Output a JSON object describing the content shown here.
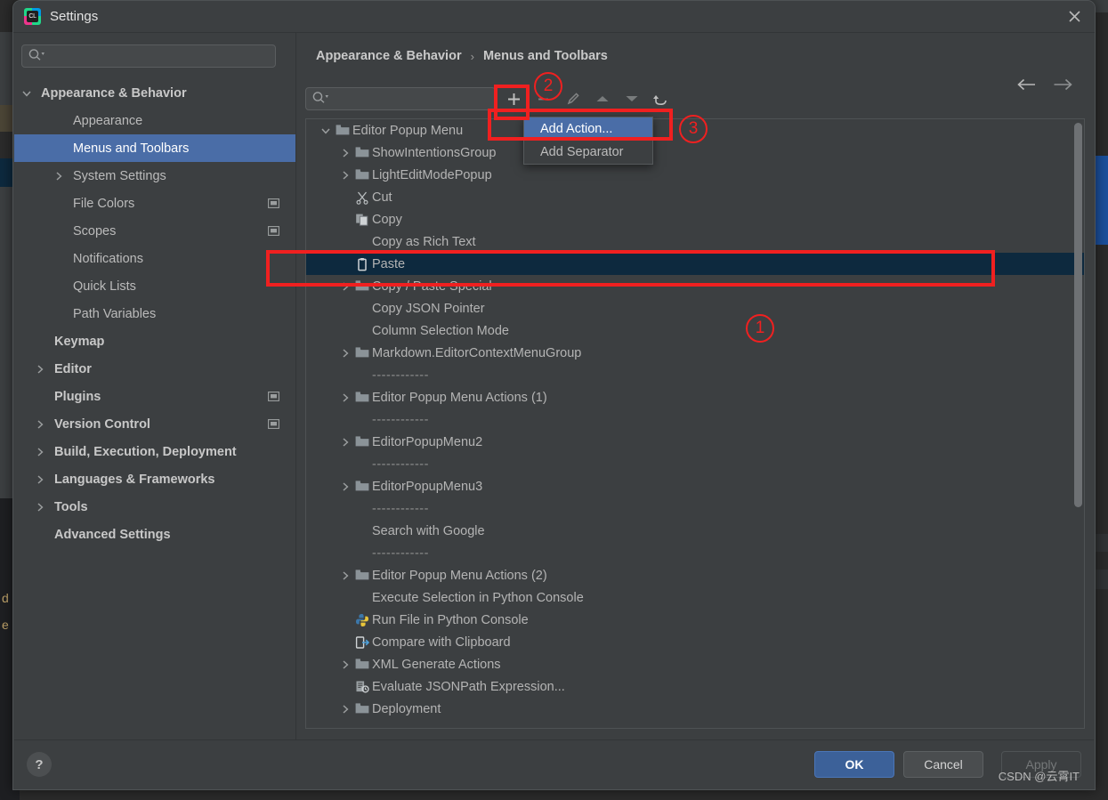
{
  "window": {
    "title": "Settings",
    "app_icon": "pycharm-logo-icon",
    "close_icon": "close-icon"
  },
  "nav_search": {
    "placeholder": "",
    "value": "",
    "icon": "search-dropdown-icon"
  },
  "sidebar": {
    "items": [
      {
        "label": "Appearance & Behavior",
        "indent": 30,
        "arrow": "chevron-down",
        "bold": true,
        "selected": false,
        "badge": false
      },
      {
        "label": "Appearance",
        "indent": 66,
        "arrow": "",
        "bold": false,
        "selected": false,
        "badge": false
      },
      {
        "label": "Menus and Toolbars",
        "indent": 66,
        "arrow": "",
        "bold": false,
        "selected": true,
        "badge": false
      },
      {
        "label": "System Settings",
        "indent": 66,
        "arrow": "chevron-right",
        "bold": false,
        "selected": false,
        "badge": false
      },
      {
        "label": "File Colors",
        "indent": 66,
        "arrow": "",
        "bold": false,
        "selected": false,
        "badge": true
      },
      {
        "label": "Scopes",
        "indent": 66,
        "arrow": "",
        "bold": false,
        "selected": false,
        "badge": true
      },
      {
        "label": "Notifications",
        "indent": 66,
        "arrow": "",
        "bold": false,
        "selected": false,
        "badge": false
      },
      {
        "label": "Quick Lists",
        "indent": 66,
        "arrow": "",
        "bold": false,
        "selected": false,
        "badge": false
      },
      {
        "label": "Path Variables",
        "indent": 66,
        "arrow": "",
        "bold": false,
        "selected": false,
        "badge": false
      },
      {
        "label": "Keymap",
        "indent": 45,
        "arrow": "",
        "bold": true,
        "selected": false,
        "badge": false
      },
      {
        "label": "Editor",
        "indent": 45,
        "arrow": "chevron-right",
        "bold": true,
        "selected": false,
        "badge": false
      },
      {
        "label": "Plugins",
        "indent": 45,
        "arrow": "",
        "bold": true,
        "selected": false,
        "badge": true
      },
      {
        "label": "Version Control",
        "indent": 45,
        "arrow": "chevron-right",
        "bold": true,
        "selected": false,
        "badge": true
      },
      {
        "label": "Build, Execution, Deployment",
        "indent": 45,
        "arrow": "chevron-right",
        "bold": true,
        "selected": false,
        "badge": false
      },
      {
        "label": "Languages & Frameworks",
        "indent": 45,
        "arrow": "chevron-right",
        "bold": true,
        "selected": false,
        "badge": false
      },
      {
        "label": "Tools",
        "indent": 45,
        "arrow": "chevron-right",
        "bold": true,
        "selected": false,
        "badge": false
      },
      {
        "label": "Advanced Settings",
        "indent": 45,
        "arrow": "",
        "bold": true,
        "selected": false,
        "badge": false
      }
    ]
  },
  "breadcrumb": {
    "root": "Appearance & Behavior",
    "separator": "›",
    "leaf": "Menus and Toolbars"
  },
  "pane_nav": {
    "back_icon": "arrow-left-icon",
    "forward_icon": "arrow-right-icon"
  },
  "tree_search": {
    "placeholder": "",
    "value": "",
    "icon": "search-dropdown-icon"
  },
  "toolbar": {
    "buttons": [
      {
        "name": "add-button",
        "label": "+",
        "icon": "plus-icon",
        "enabled": true
      },
      {
        "name": "remove-button",
        "label": "–",
        "icon": "minus-icon",
        "enabled": false
      },
      {
        "name": "edit-button",
        "label": "",
        "icon": "pencil-icon",
        "enabled": false
      },
      {
        "name": "move-up-button",
        "label": "",
        "icon": "arrow-up-icon",
        "enabled": false
      },
      {
        "name": "move-down-button",
        "label": "",
        "icon": "arrow-down-icon",
        "enabled": false
      },
      {
        "name": "restore-button",
        "label": "",
        "icon": "revert-arrow-icon",
        "enabled": true
      }
    ]
  },
  "add_menu": {
    "items": [
      {
        "label": "Add Action...",
        "highlighted": true
      },
      {
        "label": "Add Separator",
        "highlighted": false
      }
    ]
  },
  "tree": {
    "separator_text": "------------",
    "rows": [
      {
        "label": "Editor Popup Menu",
        "indent": 52,
        "arrow": "chevron-down",
        "icon": "folder-icon",
        "selected": false,
        "separator": false
      },
      {
        "label": "ShowIntentionsGroup",
        "indent": 74,
        "arrow": "chevron-right",
        "icon": "folder-icon",
        "selected": false,
        "separator": false
      },
      {
        "label": "LightEditModePopup",
        "indent": 74,
        "arrow": "chevron-right",
        "icon": "folder-icon",
        "selected": false,
        "separator": false
      },
      {
        "label": "Cut",
        "indent": 74,
        "arrow": "",
        "icon": "scissors-icon",
        "selected": false,
        "separator": false
      },
      {
        "label": "Copy",
        "indent": 74,
        "arrow": "",
        "icon": "copy-icon",
        "selected": false,
        "separator": false
      },
      {
        "label": "Copy as Rich Text",
        "indent": 74,
        "arrow": "",
        "icon": "",
        "selected": false,
        "separator": false
      },
      {
        "label": "Paste",
        "indent": 74,
        "arrow": "",
        "icon": "clipboard-icon",
        "selected": true,
        "separator": false
      },
      {
        "label": "Copy / Paste Special",
        "indent": 74,
        "arrow": "chevron-right",
        "icon": "folder-icon",
        "selected": false,
        "separator": false
      },
      {
        "label": "Copy JSON Pointer",
        "indent": 74,
        "arrow": "",
        "icon": "",
        "selected": false,
        "separator": false
      },
      {
        "label": "Column Selection Mode",
        "indent": 74,
        "arrow": "",
        "icon": "",
        "selected": false,
        "separator": false
      },
      {
        "label": "Markdown.EditorContextMenuGroup",
        "indent": 74,
        "arrow": "chevron-right",
        "icon": "folder-icon",
        "selected": false,
        "separator": false
      },
      {
        "label": "------------",
        "indent": 74,
        "arrow": "",
        "icon": "",
        "selected": false,
        "separator": true
      },
      {
        "label": "Editor Popup Menu Actions (1)",
        "indent": 74,
        "arrow": "chevron-right",
        "icon": "folder-icon",
        "selected": false,
        "separator": false
      },
      {
        "label": "------------",
        "indent": 74,
        "arrow": "",
        "icon": "",
        "selected": false,
        "separator": true
      },
      {
        "label": "EditorPopupMenu2",
        "indent": 74,
        "arrow": "chevron-right",
        "icon": "folder-icon",
        "selected": false,
        "separator": false
      },
      {
        "label": "------------",
        "indent": 74,
        "arrow": "",
        "icon": "",
        "selected": false,
        "separator": true
      },
      {
        "label": "EditorPopupMenu3",
        "indent": 74,
        "arrow": "chevron-right",
        "icon": "folder-icon",
        "selected": false,
        "separator": false
      },
      {
        "label": "------------",
        "indent": 74,
        "arrow": "",
        "icon": "",
        "selected": false,
        "separator": true
      },
      {
        "label": "Search with Google",
        "indent": 74,
        "arrow": "",
        "icon": "",
        "selected": false,
        "separator": false
      },
      {
        "label": "------------",
        "indent": 74,
        "arrow": "",
        "icon": "",
        "selected": false,
        "separator": true
      },
      {
        "label": "Editor Popup Menu Actions (2)",
        "indent": 74,
        "arrow": "chevron-right",
        "icon": "folder-icon",
        "selected": false,
        "separator": false
      },
      {
        "label": "Execute Selection in Python Console",
        "indent": 74,
        "arrow": "",
        "icon": "",
        "selected": false,
        "separator": false
      },
      {
        "label": "Run File in Python Console",
        "indent": 74,
        "arrow": "",
        "icon": "python-icon",
        "selected": false,
        "separator": false
      },
      {
        "label": "Compare with Clipboard",
        "indent": 74,
        "arrow": "",
        "icon": "compare-icon",
        "selected": false,
        "separator": false
      },
      {
        "label": "XML Generate Actions",
        "indent": 74,
        "arrow": "chevron-right",
        "icon": "folder-icon",
        "selected": false,
        "separator": false
      },
      {
        "label": "Evaluate JSONPath Expression...",
        "indent": 74,
        "arrow": "",
        "icon": "jsonpath-icon",
        "selected": false,
        "separator": false
      },
      {
        "label": "Deployment",
        "indent": 74,
        "arrow": "chevron-right",
        "icon": "folder-icon",
        "selected": false,
        "separator": false
      }
    ]
  },
  "footer": {
    "help_label": "?",
    "ok_label": "OK",
    "cancel_label": "Cancel",
    "apply_label": "Apply",
    "watermark": "CSDN @云霄IT"
  },
  "annotations": {
    "markers": [
      {
        "id": "1",
        "label": "①",
        "text": "1"
      },
      {
        "id": "2",
        "label": "②",
        "text": "2"
      },
      {
        "id": "3",
        "label": "③",
        "text": "3"
      }
    ],
    "color": "#f02020"
  },
  "background": {
    "left_letters": [
      "d",
      "e"
    ]
  }
}
